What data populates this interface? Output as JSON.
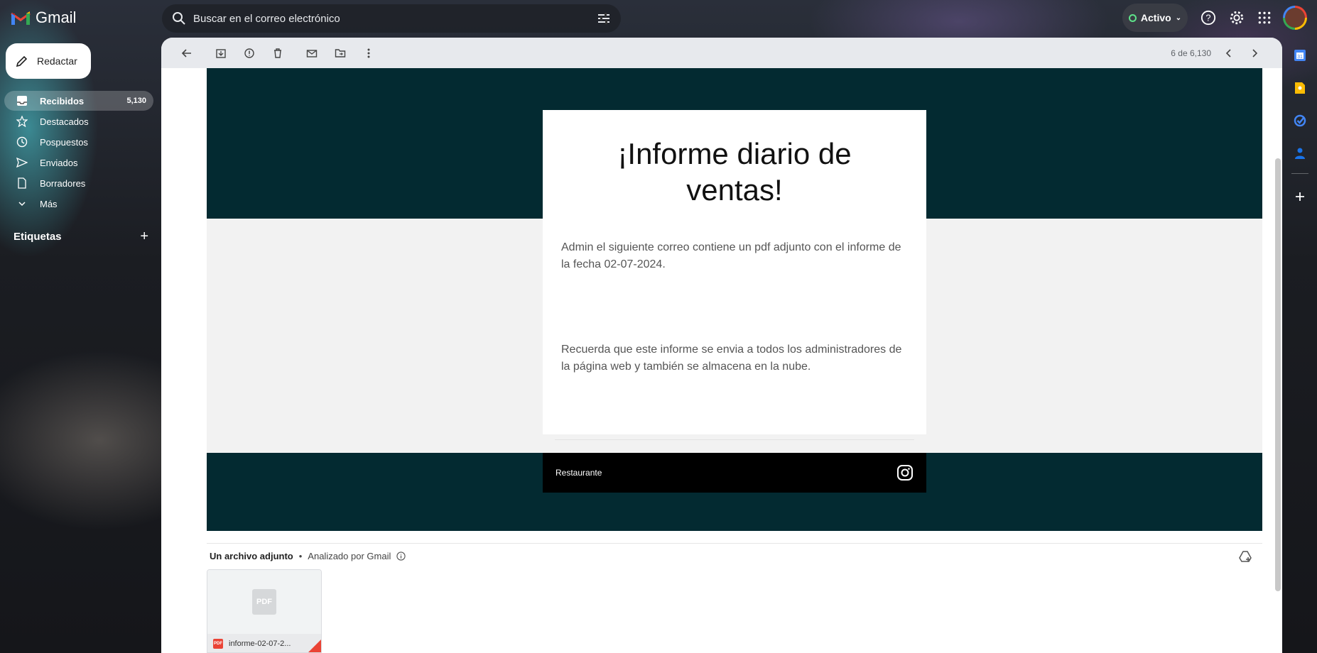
{
  "app": {
    "name": "Gmail"
  },
  "search": {
    "placeholder": "Buscar en el correo electrónico"
  },
  "status": {
    "label": "Activo"
  },
  "compose": {
    "label": "Redactar"
  },
  "nav": {
    "items": [
      {
        "label": "Recibidos",
        "count": "5,130"
      },
      {
        "label": "Destacados"
      },
      {
        "label": "Pospuestos"
      },
      {
        "label": "Enviados"
      },
      {
        "label": "Borradores"
      },
      {
        "label": "Más"
      }
    ]
  },
  "labels": {
    "title": "Etiquetas",
    "add": "+"
  },
  "toolbar": {
    "pager": "6 de 6,130"
  },
  "email": {
    "title": "¡Informe diario de ventas!",
    "paragraph1": "Admin el siguiente correo contiene un pdf adjunto con el informe de la fecha 02-07-2024.",
    "paragraph2": "Recuerda que este informe se envia a todos los administradores de la página web y también se almacena en la nube.",
    "footer_brand": "Restaurante"
  },
  "attachments": {
    "count_label": "Un archivo adjunto",
    "separator": "•",
    "scanned_label": "Analizado por Gmail",
    "file": {
      "name": "informe-02-07-2...",
      "type_badge": "PDF",
      "thumb_label": "PDF"
    }
  },
  "colors": {
    "hero": "#032a31",
    "accent_red": "#ea4335"
  }
}
